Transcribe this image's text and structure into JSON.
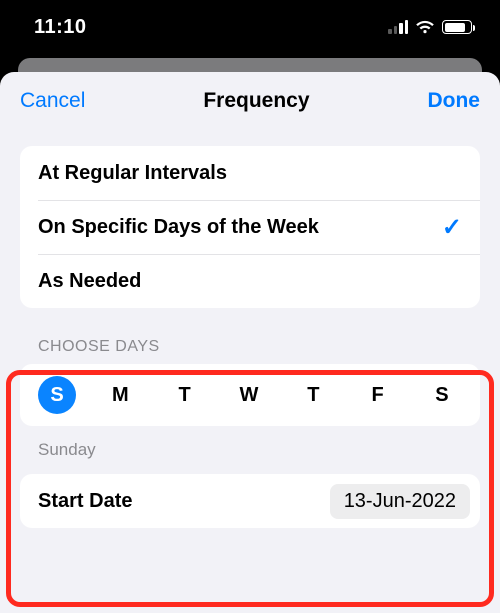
{
  "statusbar": {
    "time": "11:10"
  },
  "navbar": {
    "cancel": "Cancel",
    "title": "Frequency",
    "done": "Done"
  },
  "frequency_options": {
    "regular": "At Regular Intervals",
    "specific": "On Specific Days of the Week",
    "as_needed": "As Needed"
  },
  "choose_days": {
    "header": "CHOOSE DAYS",
    "days": [
      "S",
      "M",
      "T",
      "W",
      "T",
      "F",
      "S"
    ],
    "selected_index": 0,
    "selected_label": "Sunday"
  },
  "start_date": {
    "label": "Start Date",
    "value": "13-Jun-2022"
  }
}
